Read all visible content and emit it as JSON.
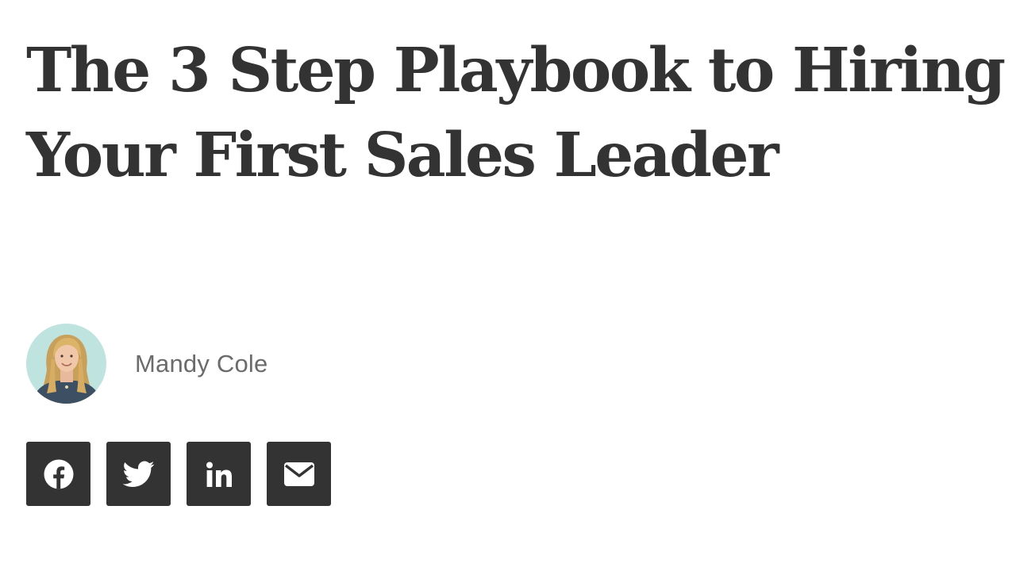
{
  "article": {
    "title": "The 3 Step Playbook to Hiring Your First Sales Leader"
  },
  "author": {
    "name": "Mandy Cole"
  },
  "share": {
    "buttons": [
      {
        "icon": "facebook-icon"
      },
      {
        "icon": "twitter-icon"
      },
      {
        "icon": "linkedin-icon"
      },
      {
        "icon": "email-icon"
      }
    ]
  },
  "colors": {
    "title": "#333333",
    "author_name": "#6b6b6b",
    "share_button_bg": "#333333",
    "share_icon": "#ffffff",
    "avatar_bg": "#bfe3df"
  }
}
